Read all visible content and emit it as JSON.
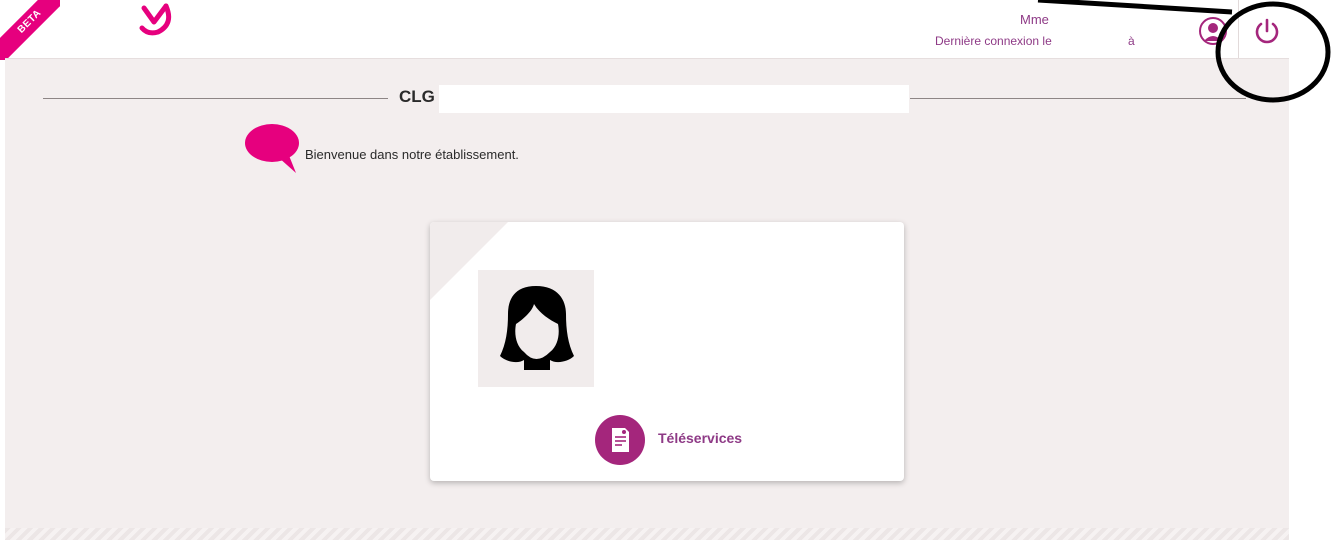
{
  "header": {
    "beta_label": "BETA",
    "user_name": "Mme",
    "last_login_label": "Dernière connexion le",
    "last_login_at": "à",
    "icons": {
      "logo": "brand-logo-icon",
      "profile": "user-profile-icon",
      "logout": "power-icon"
    }
  },
  "main": {
    "school_prefix": "CLG",
    "welcome_message": "Bienvenue dans notre établissement.",
    "card": {
      "avatar_icon": "female-avatar-icon",
      "service_label": "Téléservices",
      "service_icon": "document-icon"
    }
  },
  "colors": {
    "accent_pink": "#e6007e",
    "brand_purple": "#a4267c",
    "text_purple": "#8e3a86",
    "background": "#f3eeee"
  }
}
